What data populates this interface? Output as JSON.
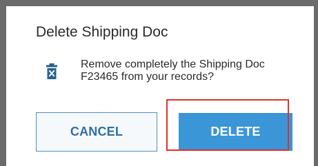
{
  "dialog": {
    "title": "Delete Shipping Doc",
    "message_line1": "Remove completely the Shipping Doc",
    "message_line2": "F23465 from your records?",
    "icon": "trash-x-icon",
    "cancel_label": "CANCEL",
    "delete_label": "DELETE"
  },
  "colors": {
    "primary": "#3a96d6",
    "cancel_text": "#2f6ea3",
    "highlight": "#e0302a",
    "icon": "#2a5f8f"
  }
}
